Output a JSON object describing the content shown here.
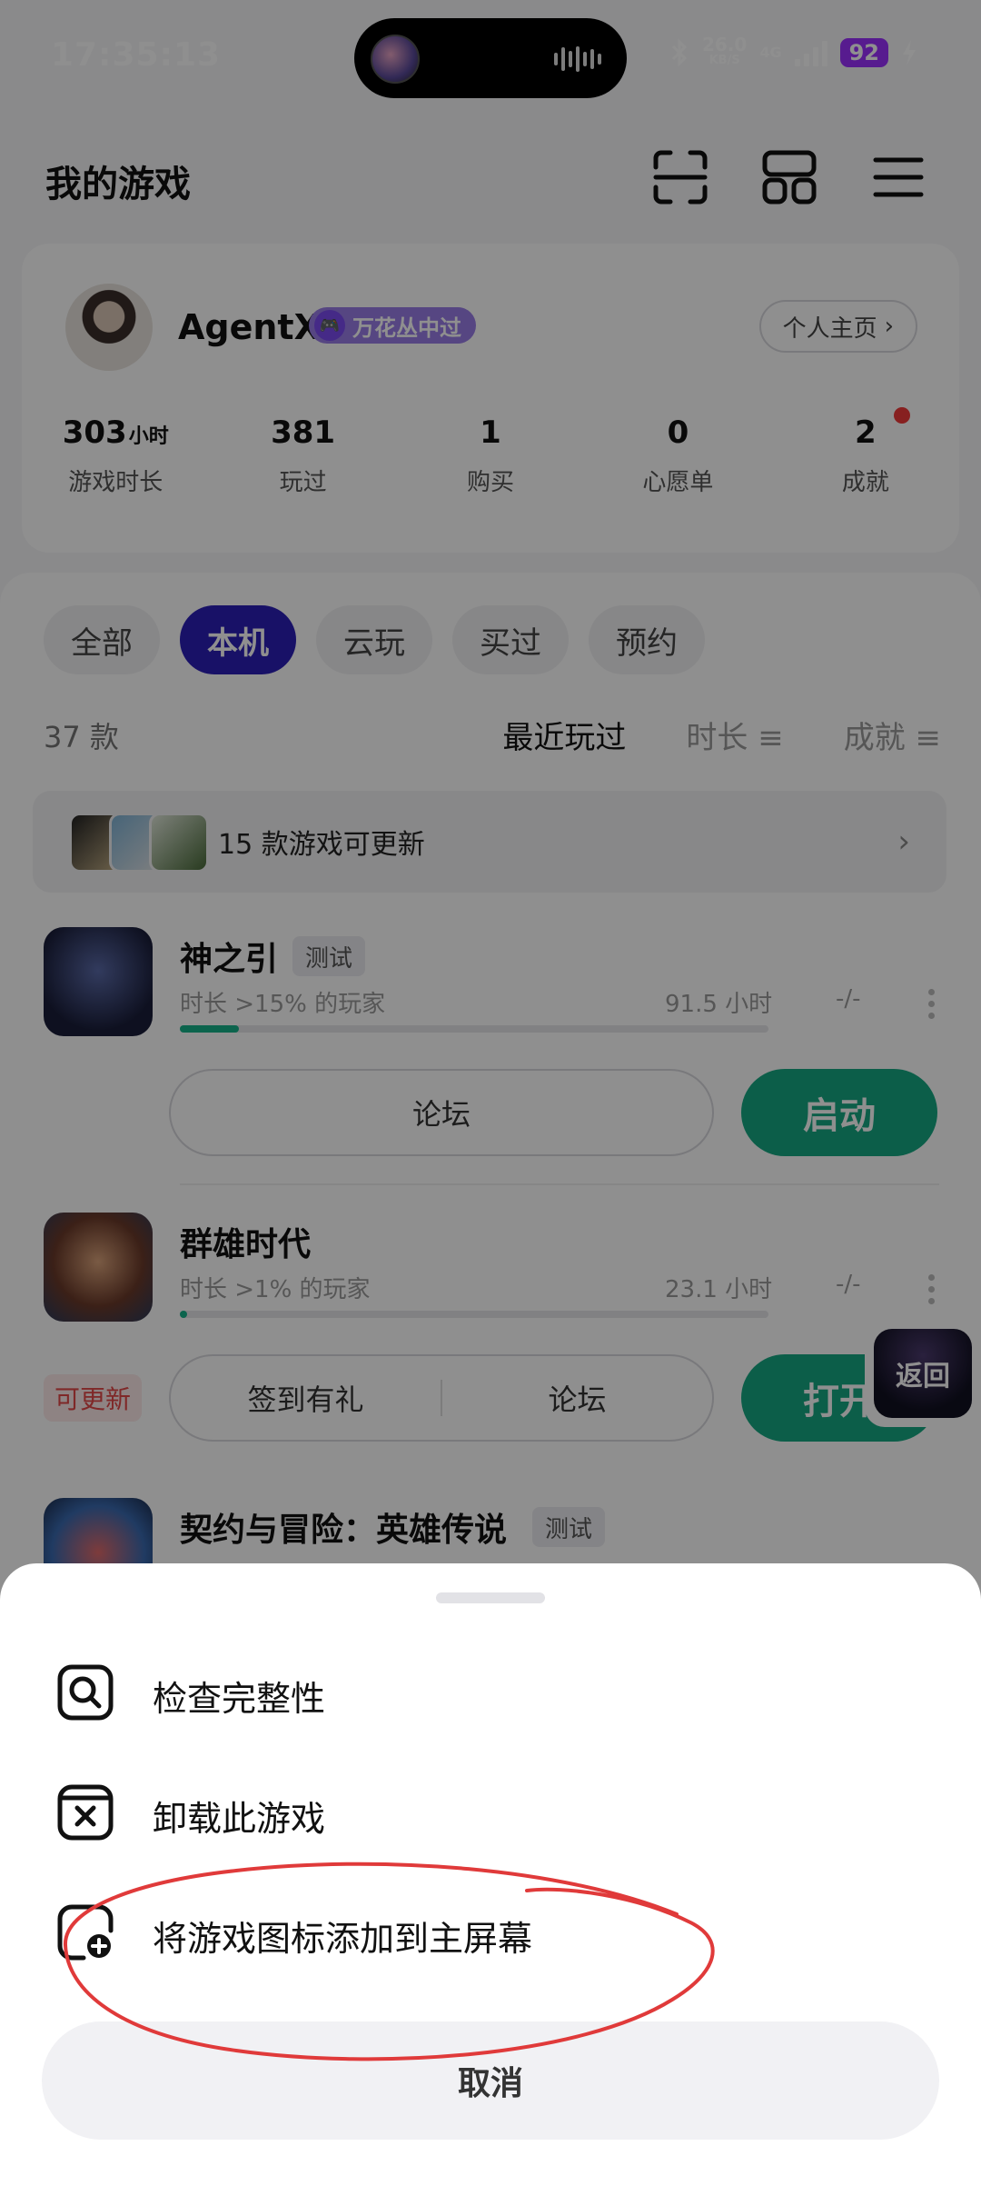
{
  "status_bar": {
    "time": "17:35:13",
    "net_speed": "26.0",
    "net_unit": "KB/S",
    "network": "4G",
    "battery": "92"
  },
  "header": {
    "title": "我的游戏",
    "icons": [
      "scan-icon",
      "grid-icon",
      "menu-icon"
    ]
  },
  "profile": {
    "name": "AgentX",
    "badge": "万花丛中过",
    "home_link": "个人主页",
    "stats": [
      {
        "value": "303",
        "unit": "小时",
        "label": "游戏时长"
      },
      {
        "value": "381",
        "unit": "",
        "label": "玩过"
      },
      {
        "value": "1",
        "unit": "",
        "label": "购买"
      },
      {
        "value": "0",
        "unit": "",
        "label": "心愿单"
      },
      {
        "value": "2",
        "unit": "",
        "label": "成就"
      }
    ]
  },
  "filters": {
    "tabs": [
      "全部",
      "本机",
      "云玩",
      "买过",
      "预约"
    ],
    "active_index": 1
  },
  "list": {
    "count": "37 款",
    "sort": [
      "最近玩过",
      "时长",
      "成就"
    ],
    "update_banner": "15 款游戏可更新"
  },
  "games": [
    {
      "name": "神之引",
      "tag": "测试",
      "sub": "时长 >15% 的玩家",
      "hours": "91.5 小时",
      "achievements": "-/-",
      "progress": 0.1,
      "buttons": [
        "论坛"
      ],
      "launch": "启动"
    },
    {
      "name": "群雄时代",
      "tag": "",
      "sub": "时长 >1% 的玩家",
      "hours": "23.1 小时",
      "achievements": "-/-",
      "progress": 0.01,
      "updatable": "可更新",
      "buttons": [
        "签到有礼",
        "论坛"
      ],
      "launch": "打开"
    },
    {
      "name": "契约与冒险：英雄传说",
      "tag": "测试"
    }
  ],
  "floating": {
    "return_label": "返回"
  },
  "sheet": {
    "items": [
      {
        "label": "检查完整性",
        "icon": "search-check-icon"
      },
      {
        "label": "卸载此游戏",
        "icon": "uninstall-icon"
      },
      {
        "label": "将游戏图标添加到主屏幕",
        "icon": "add-to-home-icon"
      }
    ],
    "cancel": "取消"
  },
  "colors": {
    "accent_tab": "#2b1fb8",
    "launch_green": "#17a882",
    "annotation_red": "#e03a3a"
  }
}
